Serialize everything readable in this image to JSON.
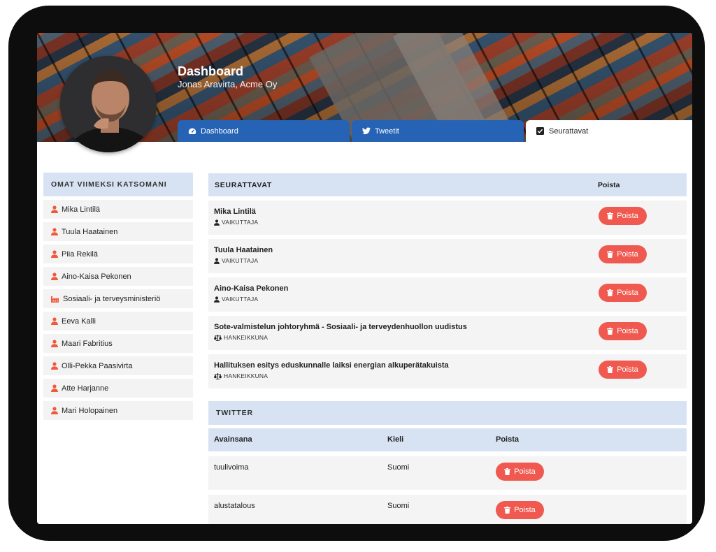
{
  "profile": {
    "title": "Dashboard",
    "subtitle": "Jonas Aravirta, Acme Oy"
  },
  "tabs": [
    {
      "label": "Dashboard",
      "icon": "tachometer-icon",
      "active": false
    },
    {
      "label": "Tweetit",
      "icon": "twitter-icon",
      "active": false
    },
    {
      "label": "Seurattavat",
      "icon": "checkbox-icon",
      "active": true
    }
  ],
  "sidebar": {
    "title": "OMAT VIIMEKSI KATSOMANI",
    "items": [
      {
        "label": "Mika Lintilä",
        "icon": "user-icon"
      },
      {
        "label": "Tuula Haatainen",
        "icon": "user-icon"
      },
      {
        "label": "Piia Rekilä",
        "icon": "user-icon"
      },
      {
        "label": "Aino-Kaisa Pekonen",
        "icon": "user-icon"
      },
      {
        "label": "Sosiaali- ja terveysministeriö",
        "icon": "industry-icon"
      },
      {
        "label": "Eeva Kalli",
        "icon": "user-icon"
      },
      {
        "label": "Maari Fabritius",
        "icon": "user-icon"
      },
      {
        "label": "Olli-Pekka Paasivirta",
        "icon": "user-icon"
      },
      {
        "label": "Atte Harjanne",
        "icon": "user-icon"
      },
      {
        "label": "Mari Holopainen",
        "icon": "user-icon"
      }
    ]
  },
  "following": {
    "title": "SEURATTAVAT",
    "column_delete": "Poista",
    "delete_label": "Poista",
    "rows": [
      {
        "name": "Mika Lintilä",
        "type": "VAIKUTTAJA",
        "type_icon": "user-icon"
      },
      {
        "name": "Tuula Haatainen",
        "type": "VAIKUTTAJA",
        "type_icon": "user-icon"
      },
      {
        "name": "Aino-Kaisa Pekonen",
        "type": "VAIKUTTAJA",
        "type_icon": "user-icon"
      },
      {
        "name": "Sote-valmistelun johtoryhmä - Sosiaali- ja terveydenhuollon uudistus",
        "type": "HANKEIKKUNA",
        "type_icon": "balance-scale-icon"
      },
      {
        "name": "Hallituksen esitys eduskunnalle laiksi energian alkuperätakuista",
        "type": "HANKEIKKUNA",
        "type_icon": "balance-scale-icon"
      }
    ]
  },
  "twitter": {
    "title": "TWITTER",
    "columns": [
      "Avainsana",
      "Kieli",
      "Poista"
    ],
    "delete_label": "Poista",
    "rows": [
      {
        "keyword": "tuulivoima",
        "language": "Suomi"
      },
      {
        "keyword": "alustatalous",
        "language": "Suomi"
      }
    ]
  },
  "colors": {
    "tab_blue": "#2663b5",
    "header_light_blue": "#d7e3f2",
    "delete_red": "#ef5950",
    "icon_red": "#f05a3a",
    "device_frame": "#0d0d0d"
  }
}
